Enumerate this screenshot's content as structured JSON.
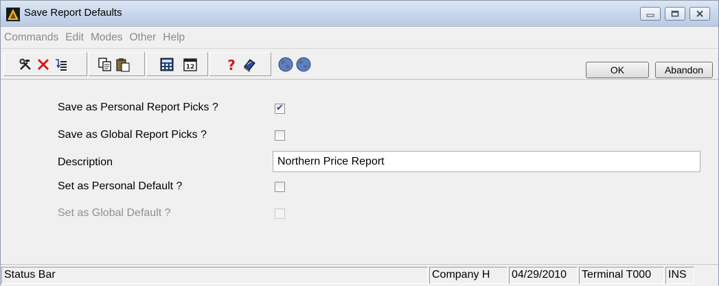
{
  "window": {
    "title": "Save Report Defaults"
  },
  "menu": [
    "Commands",
    "Edit",
    "Modes",
    "Other",
    "Help"
  ],
  "toolbar": {
    "ok_label": "OK",
    "abandon_label": "Abandon"
  },
  "form": {
    "save_personal_label": "Save as Personal Report Picks ?",
    "save_personal_checked": true,
    "save_global_label": "Save as Global Report Picks ?",
    "save_global_checked": false,
    "description_label": "Description",
    "description_value": "Northern Price Report",
    "personal_default_label": "Set as Personal Default ?",
    "personal_default_checked": false,
    "global_default_label": "Set as Global Default ?",
    "global_default_checked": false,
    "checkmark_glyph": "✔"
  },
  "status": {
    "text": "Status Bar",
    "company": "Company H",
    "date": "04/29/2010",
    "terminal": "Terminal T000",
    "mode": "INS"
  },
  "colors": {
    "accent": "#2b4a8c",
    "disabled_text": "#8f8f8f"
  }
}
